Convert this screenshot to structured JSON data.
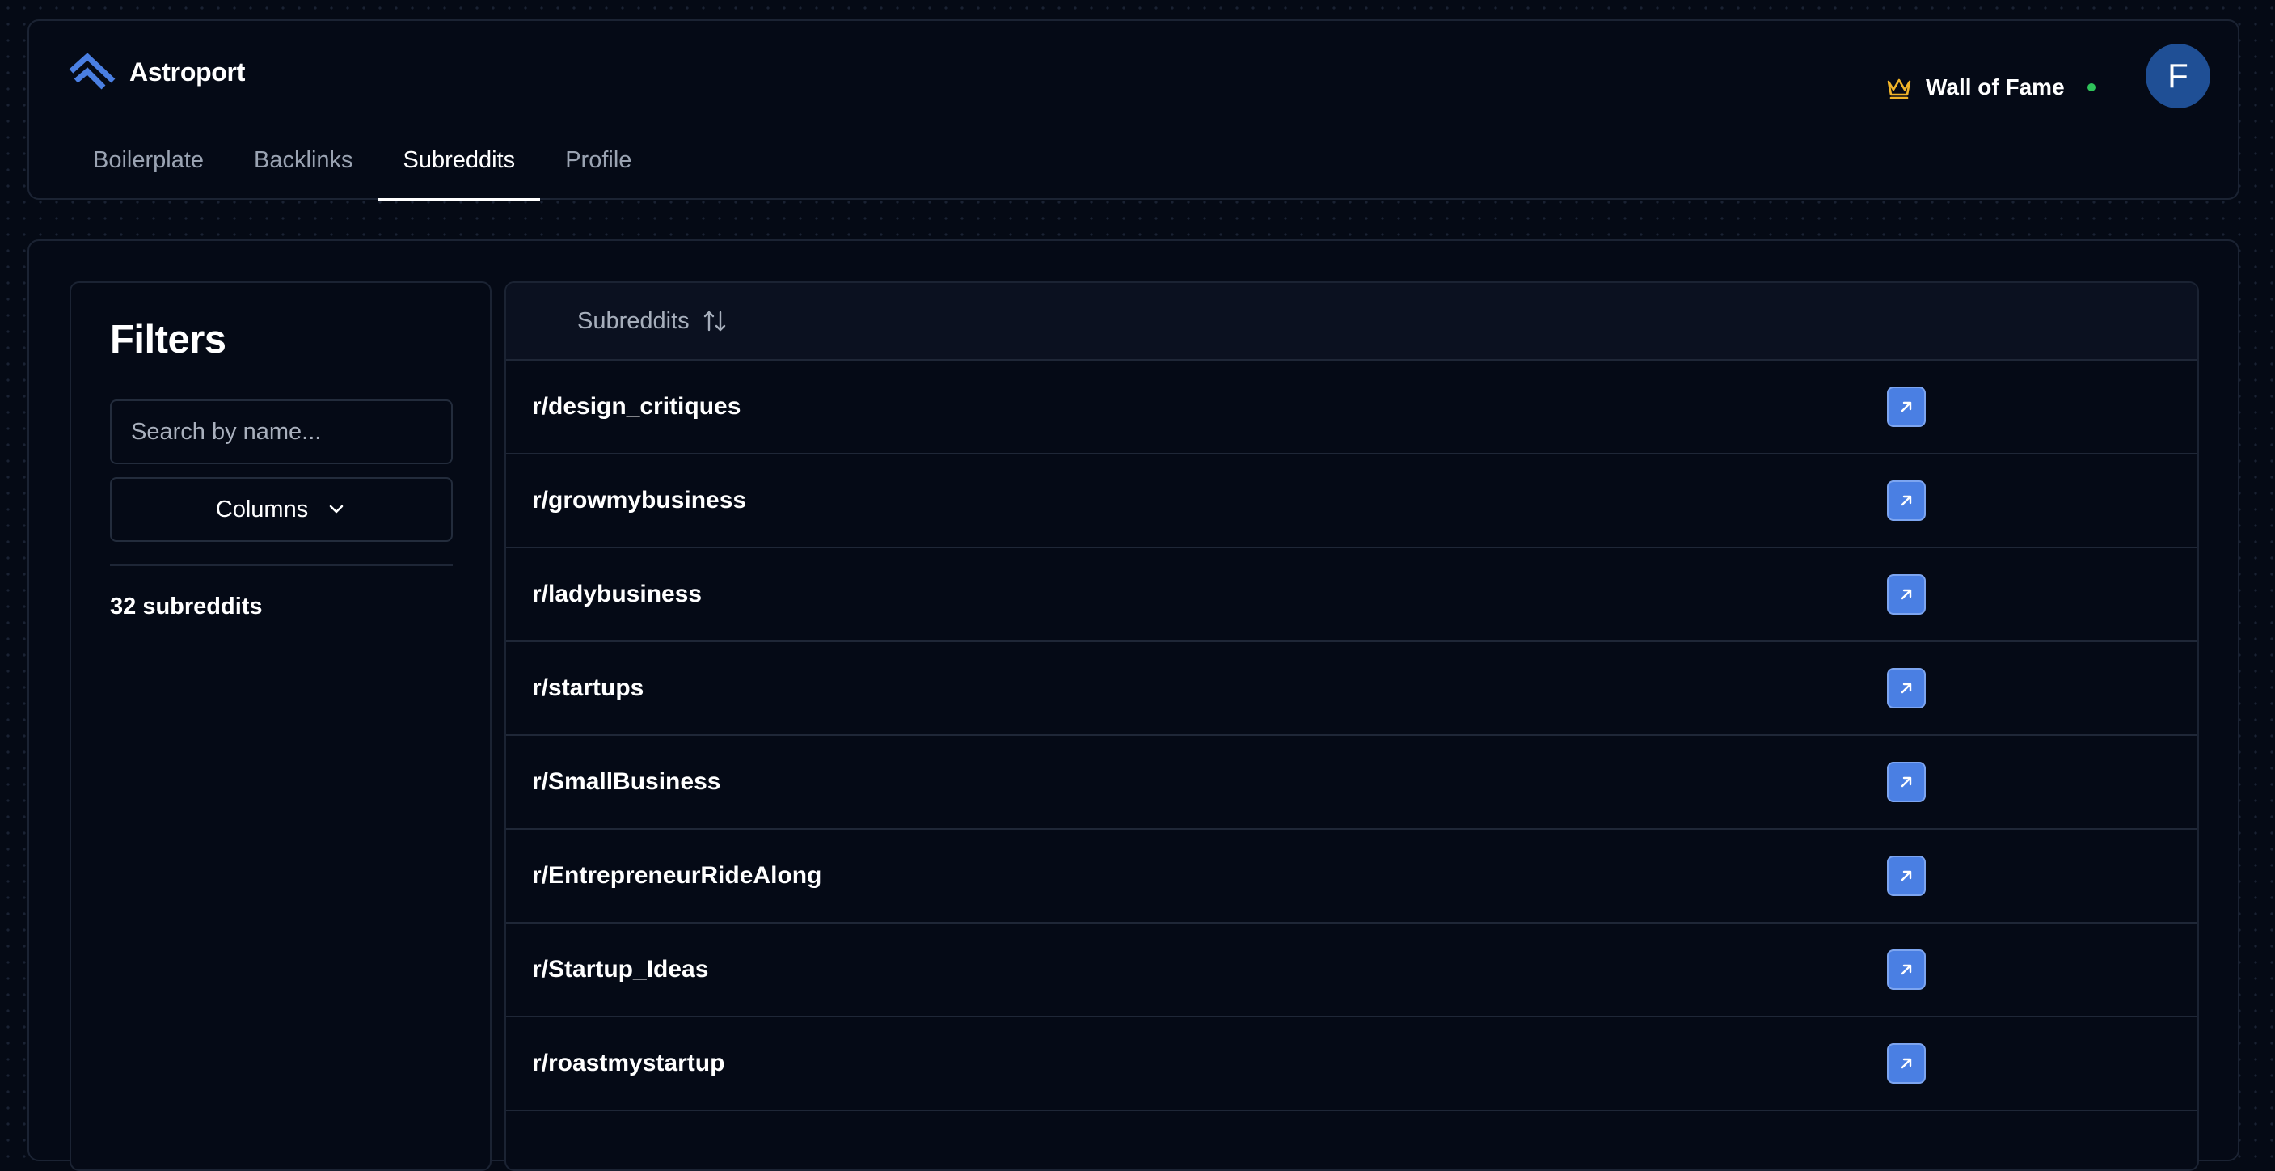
{
  "app": {
    "name": "Astroport",
    "logo_icon": "astroport-chevrons-icon",
    "accent_color": "#4a7fe3"
  },
  "header": {
    "wall_of_fame_label": "Wall of Fame",
    "wall_of_fame_icon": "crown-icon",
    "crown_color": "#f0b429",
    "status_dot_color": "#2fc35a",
    "avatar_initial": "F",
    "avatar_color": "#1f4f95"
  },
  "tabs": [
    {
      "label": "Boilerplate",
      "active": false
    },
    {
      "label": "Backlinks",
      "active": false
    },
    {
      "label": "Subreddits",
      "active": true
    },
    {
      "label": "Profile",
      "active": false
    }
  ],
  "filters": {
    "title": "Filters",
    "search_placeholder": "Search by name...",
    "search_value": "",
    "columns_label": "Columns",
    "count_text": "32 subreddits"
  },
  "table": {
    "column_header": "Subreddits",
    "sort_icon": "sort-arrows-icon",
    "rows": [
      {
        "name": "r/design_critiques",
        "action_icon": "external-link-arrow-icon"
      },
      {
        "name": "r/growmybusiness",
        "action_icon": "external-link-arrow-icon"
      },
      {
        "name": "r/ladybusiness",
        "action_icon": "external-link-arrow-icon"
      },
      {
        "name": "r/startups",
        "action_icon": "external-link-arrow-icon"
      },
      {
        "name": "r/SmallBusiness",
        "action_icon": "external-link-arrow-icon"
      },
      {
        "name": "r/EntrepreneurRideAlong",
        "action_icon": "external-link-arrow-icon"
      },
      {
        "name": "r/Startup_Ideas",
        "action_icon": "external-link-arrow-icon"
      },
      {
        "name": "r/roastmystartup",
        "action_icon": "external-link-arrow-icon"
      },
      {
        "name": "",
        "action_icon": ""
      }
    ]
  }
}
